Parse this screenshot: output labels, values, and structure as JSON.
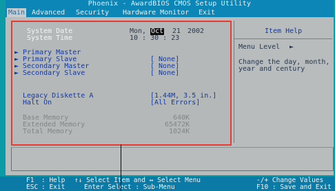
{
  "window": {
    "title": "Phoenix - AwardBIOS CMOS Setup Utility"
  },
  "menu": {
    "items": [
      {
        "label": "Main",
        "active": true
      },
      {
        "label": "Advanced",
        "active": false
      },
      {
        "label": "Security",
        "active": false
      },
      {
        "label": "Hardware Monitor",
        "active": false
      },
      {
        "label": "Exit",
        "active": false
      }
    ]
  },
  "settings": {
    "system_date": {
      "label": "System Date",
      "day": "Mon,",
      "month": "Oct",
      "date": "21",
      "year": "2002"
    },
    "system_time": {
      "label": "System Time",
      "value": "10 : 30 : 23"
    },
    "primary_master": {
      "label": "Primary Master",
      "value": ""
    },
    "primary_slave": {
      "label": "Primary Slave",
      "value": "[ None]"
    },
    "secondary_master": {
      "label": "Secondary Master",
      "value": "[ None]"
    },
    "secondary_slave": {
      "label": "Secondary Slave",
      "value": "[ None]"
    },
    "legacy_diskette": {
      "label": "Legacy Diskette A",
      "value": "[1.44M, 3.5 in.]"
    },
    "halt_on": {
      "label": "Halt On",
      "value": "[All Errors]"
    },
    "base_memory": {
      "label": "Base Memory",
      "value": "640K"
    },
    "extended_memory": {
      "label": "Extended Memory",
      "value": "65472K"
    },
    "total_memory": {
      "label": "Total Memory",
      "value": "1024K"
    },
    "submenu_arrow": "►"
  },
  "help": {
    "title": "Item Help",
    "menu_level_label": "Menu Level",
    "menu_level_arrow": "►",
    "text_line1": "Change the day, month,",
    "text_line2": "year and century"
  },
  "footer": {
    "f1_key": "F1",
    "f1_label": ": Help",
    "esc_key": "ESC",
    "esc_label": ": Exit",
    "select_item": "↑↓ Select Item and ↔ Select Menu",
    "enter": "Enter Select : Sub-Menu",
    "change_values": "-/+ Change Values",
    "f10": "F10 : Save and Exit"
  },
  "colors": {
    "bios_bg": "#b8bcbc",
    "title_bar": "#0c86b6",
    "highlight_border": "#e83a30",
    "label_white": "#f2f6f6",
    "value_blue": "#1038a8"
  }
}
